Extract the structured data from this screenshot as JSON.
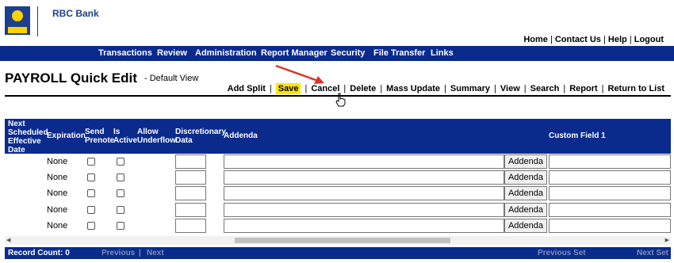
{
  "brand": {
    "name": "RBC Bank",
    "logo_text": "RBC",
    "accent": "#0a2a8c",
    "logo_yellow": "#ffd200"
  },
  "top_links": [
    "Home",
    "Contact Us",
    "Help",
    "Logout"
  ],
  "nav": [
    "Transactions",
    "Review",
    "Administration",
    "Report Manager",
    "Security",
    "File Transfer",
    "Links"
  ],
  "page": {
    "title": "PAYROLL Quick Edit",
    "subtitle": "- Default View"
  },
  "actions": [
    "Add Split",
    "Save",
    "Cancel",
    "Delete",
    "Mass Update",
    "Summary",
    "View",
    "Search",
    "Report",
    "Return to List"
  ],
  "columns": {
    "next_date": "Next Scheduled Effective Date",
    "expiration": "Expiration",
    "send_prenote": "Send Prenote",
    "is_active": "Is Active",
    "allow_underflow": "Allow Underflow",
    "discretionary": "Discretionary Data",
    "addenda": "Addenda",
    "custom1": "Custom Field 1"
  },
  "rows": [
    {
      "expiration": "None",
      "addenda_button": "Addenda"
    },
    {
      "expiration": "None",
      "addenda_button": "Addenda"
    },
    {
      "expiration": "None",
      "addenda_button": "Addenda"
    },
    {
      "expiration": "None",
      "addenda_button": "Addenda"
    },
    {
      "expiration": "None",
      "addenda_button": "Addenda"
    }
  ],
  "footer": {
    "record_count": "Record Count: 0",
    "previous": "Previous",
    "next": "Next",
    "previous_set": "Previous Set",
    "next_set": "Next Set"
  }
}
